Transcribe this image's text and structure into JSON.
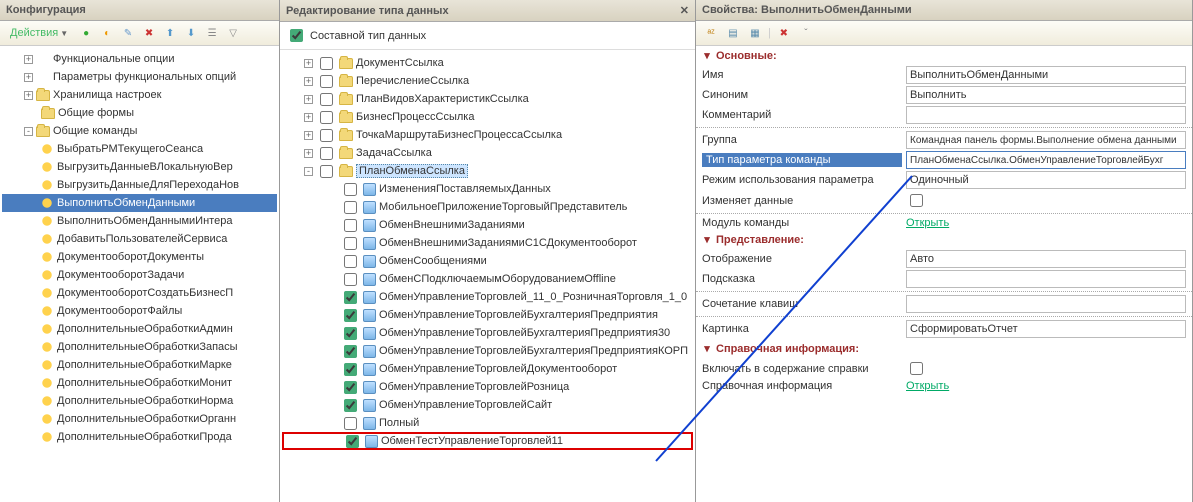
{
  "left": {
    "title": "Конфигурация",
    "actions_label": "Действия",
    "nodes": [
      {
        "icon": "dots",
        "label": "Функциональные опции",
        "exp": "+",
        "ind": 1
      },
      {
        "icon": "dots",
        "label": "Параметры функциональных опций",
        "exp": "+",
        "ind": 1
      },
      {
        "icon": "folder",
        "label": "Хранилища настроек",
        "exp": "+",
        "ind": 1
      },
      {
        "icon": "folder",
        "label": "Общие формы",
        "exp": "",
        "ind": 1
      },
      {
        "icon": "folder",
        "label": "Общие команды",
        "exp": "-",
        "ind": 1
      },
      {
        "icon": "sun",
        "label": "ВыбратьРМТекущегоСеанса",
        "ind": 2
      },
      {
        "icon": "sun",
        "label": "ВыгрузитьДанныеВЛокальнуюВер",
        "ind": 2
      },
      {
        "icon": "sun",
        "label": "ВыгрузитьДанныеДляПереходаНов",
        "ind": 2
      },
      {
        "icon": "sun",
        "label": "ВыполнитьОбменДанными",
        "ind": 2,
        "selected": true
      },
      {
        "icon": "sun",
        "label": "ВыполнитьОбменДаннымиИнтера",
        "ind": 2
      },
      {
        "icon": "sun",
        "label": "ДобавитьПользователейСервиса",
        "ind": 2
      },
      {
        "icon": "sun",
        "label": "ДокументооборотДокументы",
        "ind": 2
      },
      {
        "icon": "sun",
        "label": "ДокументооборотЗадачи",
        "ind": 2
      },
      {
        "icon": "sun",
        "label": "ДокументооборотСоздатьБизнесП",
        "ind": 2
      },
      {
        "icon": "sun",
        "label": "ДокументооборотФайлы",
        "ind": 2
      },
      {
        "icon": "sun",
        "label": "ДополнительныеОбработкиАдмин",
        "ind": 2
      },
      {
        "icon": "sun",
        "label": "ДополнительныеОбработкиЗапасы",
        "ind": 2
      },
      {
        "icon": "sun",
        "label": "ДополнительныеОбработкиМарке",
        "ind": 2
      },
      {
        "icon": "sun",
        "label": "ДополнительныеОбработкиМонит",
        "ind": 2
      },
      {
        "icon": "sun",
        "label": "ДополнительныеОбработкиНорма",
        "ind": 2
      },
      {
        "icon": "sun",
        "label": "ДополнительныеОбработкиОрганн",
        "ind": 2
      },
      {
        "icon": "sun",
        "label": "ДополнительныеОбработкиПрода",
        "ind": 2
      }
    ]
  },
  "middle": {
    "title": "Редактирование типа данных",
    "composite_label": "Составной тип данных",
    "nodes": [
      {
        "icon": "folder",
        "label": "ДокументСсылка",
        "exp": "+",
        "ind": 1,
        "chk": false
      },
      {
        "icon": "folder",
        "label": "ПеречислениеСсылка",
        "exp": "+",
        "ind": 1,
        "chk": false
      },
      {
        "icon": "folder",
        "label": "ПланВидовХарактеристикСсылка",
        "exp": "+",
        "ind": 1,
        "chk": false
      },
      {
        "icon": "folder",
        "label": "БизнесПроцессСсылка",
        "exp": "+",
        "ind": 1,
        "chk": false
      },
      {
        "icon": "folder",
        "label": "ТочкаМаршрутаБизнесПроцессаСсылка",
        "exp": "+",
        "ind": 1,
        "chk": false
      },
      {
        "icon": "folder",
        "label": "ЗадачаСсылка",
        "exp": "+",
        "ind": 1,
        "chk": false
      },
      {
        "icon": "folder",
        "label": "ПланОбменаСсылка",
        "exp": "-",
        "ind": 1,
        "chk": false,
        "hi": true
      },
      {
        "icon": "obj",
        "label": "ИзмененияПоставляемыхДанных",
        "ind": 2,
        "chk": false
      },
      {
        "icon": "obj",
        "label": "МобильноеПриложениеТорговыйПредставитель",
        "ind": 2,
        "chk": false
      },
      {
        "icon": "obj",
        "label": "ОбменВнешнимиЗаданиями",
        "ind": 2,
        "chk": false
      },
      {
        "icon": "obj",
        "label": "ОбменВнешнимиЗаданиямиС1СДокументооборот",
        "ind": 2,
        "chk": false
      },
      {
        "icon": "obj",
        "label": "ОбменСообщениями",
        "ind": 2,
        "chk": false
      },
      {
        "icon": "obj",
        "label": "ОбменСПодключаемымОборудованиемOffline",
        "ind": 2,
        "chk": false
      },
      {
        "icon": "obj",
        "label": "ОбменУправлениеТорговлей_11_0_РозничнаяТорговля_1_0",
        "ind": 2,
        "chk": true
      },
      {
        "icon": "obj",
        "label": "ОбменУправлениеТорговлейБухгалтерияПредприятия",
        "ind": 2,
        "chk": true
      },
      {
        "icon": "obj",
        "label": "ОбменУправлениеТорговлейБухгалтерияПредприятия30",
        "ind": 2,
        "chk": true
      },
      {
        "icon": "obj",
        "label": "ОбменУправлениеТорговлейБухгалтерияПредприятияКОРП",
        "ind": 2,
        "chk": true
      },
      {
        "icon": "obj",
        "label": "ОбменУправлениеТорговлейДокументооборот",
        "ind": 2,
        "chk": true
      },
      {
        "icon": "obj",
        "label": "ОбменУправлениеТорговлейРозница",
        "ind": 2,
        "chk": true
      },
      {
        "icon": "obj",
        "label": "ОбменУправлениеТорговлейСайт",
        "ind": 2,
        "chk": true
      },
      {
        "icon": "obj",
        "label": "Полный",
        "ind": 2,
        "chk": false
      },
      {
        "icon": "obj",
        "label": "ОбменТестУправлениеТорговлей11",
        "ind": 2,
        "chk": true,
        "red": true
      }
    ]
  },
  "right": {
    "title": "Свойства: ВыполнитьОбменДанными",
    "sections": {
      "main": "Основные:",
      "pres": "Представление:",
      "ref": "Справочная информация:"
    },
    "labels": {
      "name": "Имя",
      "synonym": "Синоним",
      "comment": "Комментарий",
      "group": "Группа",
      "param_type": "Тип параметра команды",
      "usage_mode": "Режим использования параметра",
      "modifies": "Изменяет данные",
      "module": "Модуль команды",
      "open": "Открыть",
      "display": "Отображение",
      "hint": "Подсказка",
      "shortcut": "Сочетание клавиш",
      "picture": "Картинка",
      "include_help": "Включать в содержание справки",
      "help_info": "Справочная информация"
    },
    "values": {
      "name": "ВыполнитьОбменДанными",
      "synonym": "Выполнить",
      "comment": "",
      "group": "Командная панель формы.Выполнение обмена данными",
      "param_type": "ПланОбменаСсылка.ОбменУправлениеТорговлейБухг",
      "usage_mode": "Одиночный",
      "display": "Авто",
      "hint": "",
      "shortcut": "",
      "picture": "СформироватьОтчет"
    }
  }
}
